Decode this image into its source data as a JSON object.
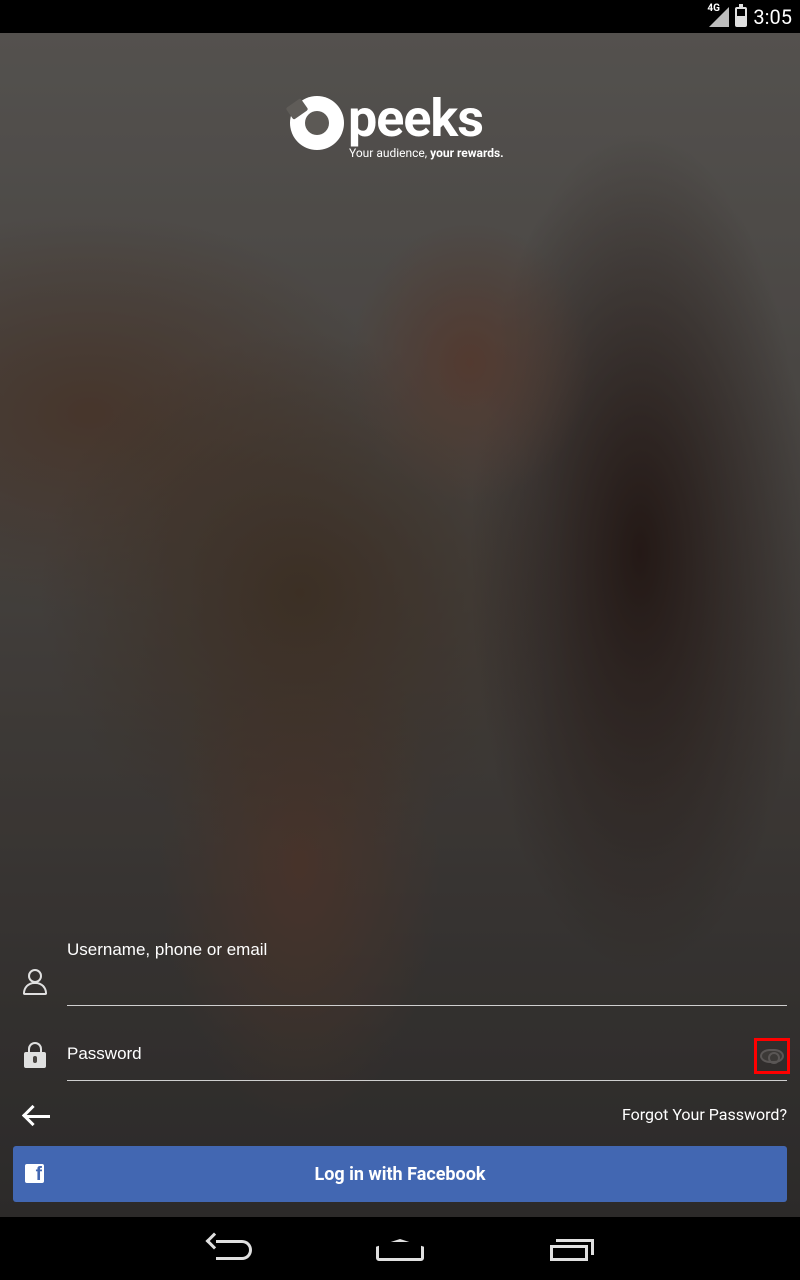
{
  "status_bar": {
    "network": "4G",
    "time": "3:05"
  },
  "brand": {
    "name": "peeks",
    "tagline_regular": "Your audience, ",
    "tagline_bold": "your rewards."
  },
  "form": {
    "username_placeholder": "Username, phone or email",
    "username_value": "",
    "password_placeholder": "Password",
    "password_value": ""
  },
  "links": {
    "forgot_password": "Forgot Your Password?"
  },
  "buttons": {
    "facebook_login": "Log in with Facebook",
    "facebook_letter": "f"
  },
  "icons": {
    "user": "user-icon",
    "lock": "lock-icon",
    "eye": "eye-icon",
    "back": "back-arrow-icon",
    "facebook": "facebook-icon"
  },
  "colors": {
    "facebook_blue": "#4267b2",
    "highlight": "#ff0000"
  }
}
